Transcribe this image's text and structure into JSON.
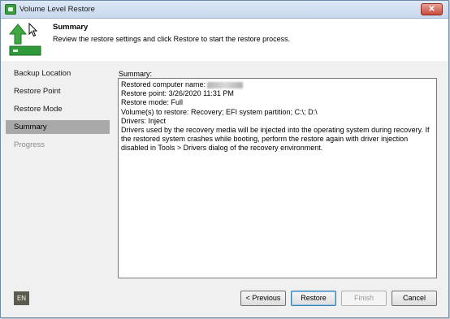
{
  "window": {
    "title": "Volume Level Restore",
    "close_icon": "✕"
  },
  "header": {
    "title": "Summary",
    "description": "Review the restore settings and click Restore to start the restore process."
  },
  "sidebar": {
    "items": [
      {
        "label": "Backup Location",
        "state": "normal"
      },
      {
        "label": "Restore Point",
        "state": "normal"
      },
      {
        "label": "Restore Mode",
        "state": "normal"
      },
      {
        "label": "Summary",
        "state": "active"
      },
      {
        "label": "Progress",
        "state": "disabled"
      }
    ]
  },
  "summary": {
    "label": "Summary:",
    "lines": [
      "Restored computer name:",
      "Restore point: 3/26/2020 11:31 PM",
      "Restore mode: Full",
      "Volume(s) to restore: Recovery; EFI system partition; C:\\; D:\\",
      "Drivers: Inject",
      "Drivers used by the recovery media will be injected into the operating system during recovery. If the restored system crashes while booting, perform the restore again with driver injection disabled in Tools > Drivers dialog of the recovery environment."
    ]
  },
  "footer": {
    "language": "EN",
    "previous_label": "< Previous",
    "restore_label": "Restore",
    "finish_label": "Finish",
    "cancel_label": "Cancel"
  },
  "colors": {
    "active_step_bg": "#a9a9a9",
    "title_bar": "#c7d8ec",
    "close_button": "#c74b3c",
    "icon_green": "#3b9b3f"
  }
}
